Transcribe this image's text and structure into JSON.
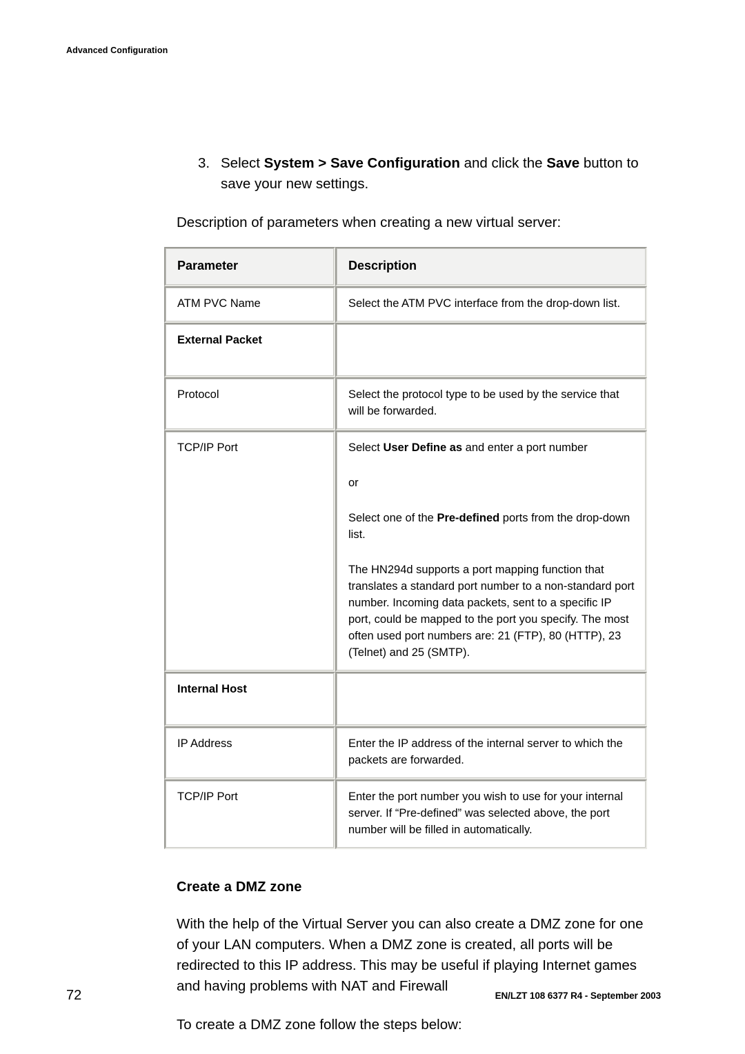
{
  "running_header": "Advanced Configuration",
  "step": {
    "number": "3.",
    "text_before_bold1": "Select ",
    "bold1": "System > Save Configuration",
    "text_mid": " and click the ",
    "bold2": "Save",
    "text_after": " button to save your new settings."
  },
  "lead_in": "Description of parameters when creating a new virtual server:",
  "table": {
    "headers": {
      "parameter": "Parameter",
      "description": "Description"
    },
    "rows": [
      {
        "parameter": "ATM PVC Name",
        "description": "Select the ATM PVC interface from the drop-down list.",
        "kind": "normal"
      },
      {
        "parameter": "External Packet",
        "description": "",
        "kind": "section"
      },
      {
        "parameter": "Protocol",
        "description": "Select the protocol type to be used by the service that will be forwarded.",
        "kind": "normal"
      },
      {
        "parameter": "TCP/IP Port",
        "description": "",
        "kind": "tall",
        "paragraphs": {
          "p1_before": "Select ",
          "p1_bold": "User Define as",
          "p1_after": " and enter a port number",
          "p2": "or",
          "p3_before": "Select one of the ",
          "p3_bold": "Pre-defined",
          "p3_after": " ports from the drop-down list.",
          "p4": "The HN294d supports a port mapping function that translates a standard port number to a non-standard port number. Incoming data packets, sent to a specific IP port, could be mapped to the port you specify. The most often used port numbers are: 21 (FTP), 80 (HTTP), 23 (Telnet) and 25 (SMTP)."
        }
      },
      {
        "parameter": "Internal Host",
        "description": "",
        "kind": "section"
      },
      {
        "parameter": "IP Address",
        "description": "Enter the IP address of the internal server to which the packets are forwarded.",
        "kind": "normal"
      },
      {
        "parameter": "TCP/IP Port",
        "description": "Enter the port number you wish to use for your internal server. If “Pre-defined” was selected above, the port number will be filled in automatically.",
        "kind": "normal"
      }
    ]
  },
  "dmz": {
    "heading": "Create a DMZ zone",
    "paragraph": "With the help of the Virtual Server you can also create a DMZ zone for one of your LAN computers. When a DMZ zone is created, all ports will be redirected to this IP address. This may be useful if playing Internet games and having problems with NAT and Firewall",
    "follow_up": "To create a DMZ zone follow the steps below:"
  },
  "footer": {
    "page_number": "72",
    "document_id": "EN/LZT 108 6377 R4 - September 2003"
  }
}
